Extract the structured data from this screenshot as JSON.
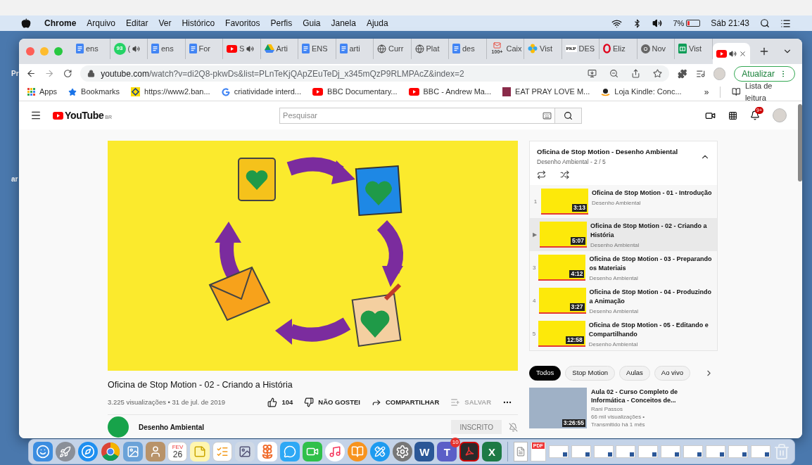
{
  "menu_bar": {
    "app": "Chrome",
    "menus": [
      "Arquivo",
      "Editar",
      "Ver",
      "Histórico",
      "Favoritos",
      "Perfis",
      "Guia",
      "Janela",
      "Ajuda"
    ],
    "battery": "7%",
    "clock": "Sáb 21:43"
  },
  "desktop_labels": [
    "Pr",
    "ar"
  ],
  "tabs": [
    {
      "kind": "docs",
      "title": "ens",
      "audio": false,
      "selected": false
    },
    {
      "kind": "whatsapp",
      "badge": "93",
      "title": "(",
      "audio": true,
      "selected": false
    },
    {
      "kind": "docs",
      "title": "ens",
      "audio": false,
      "selected": false
    },
    {
      "kind": "docs",
      "title": "For",
      "audio": false,
      "selected": false
    },
    {
      "kind": "youtube",
      "title": "S",
      "audio": true,
      "selected": false
    },
    {
      "kind": "drive",
      "title": "Arti",
      "audio": false,
      "selected": false
    },
    {
      "kind": "docs",
      "title": "ENS",
      "audio": false,
      "selected": false
    },
    {
      "kind": "docs",
      "title": "arti",
      "audio": false,
      "selected": false
    },
    {
      "kind": "globe",
      "title": "Curr",
      "audio": false,
      "selected": false
    },
    {
      "kind": "globe",
      "title": "Plat",
      "audio": false,
      "selected": false
    },
    {
      "kind": "docs",
      "title": "des",
      "audio": false,
      "selected": false
    },
    {
      "kind": "gmail",
      "badge": "100+",
      "title": "Caix",
      "audio": false,
      "selected": false
    },
    {
      "kind": "pinwheel",
      "title": "Vist",
      "audio": false,
      "selected": false
    },
    {
      "kind": "pkp",
      "badge": "PKP",
      "title": "DES",
      "audio": false,
      "selected": false
    },
    {
      "kind": "opera",
      "title": "Eliz",
      "audio": false,
      "selected": false
    },
    {
      "kind": "chrome",
      "title": "Nov",
      "audio": false,
      "selected": false
    },
    {
      "kind": "sheets",
      "title": "Vist",
      "audio": false,
      "selected": false
    },
    {
      "kind": "youtube",
      "audio": true,
      "selected": true
    }
  ],
  "address_bar": {
    "domain": "youtube.com",
    "path": "/watch?v=di2Q8-pkwDs&list=PLnTeKjQApZEuTeDj_x345mQzP9RLMPAcZ&index=2"
  },
  "update_button": "Atualizar",
  "bookmarks": [
    {
      "kind": "apps",
      "label": "Apps"
    },
    {
      "kind": "star",
      "label": "Bookmarks"
    },
    {
      "kind": "bank",
      "label": "https://www2.ban..."
    },
    {
      "kind": "google",
      "label": "criatividade interd..."
    },
    {
      "kind": "youtube",
      "label": "BBC Documentary..."
    },
    {
      "kind": "youtube",
      "label": "BBC - Andrew Ma..."
    },
    {
      "kind": "book",
      "label": "EAT PRAY LOVE M..."
    },
    {
      "kind": "amazon",
      "label": "Loja Kindle: Conc..."
    }
  ],
  "bookmarks_overflow": "»",
  "reading_list": "Lista de leitura",
  "youtube": {
    "logo": "YouTube",
    "region": "BR",
    "search_placeholder": "Pesquisar",
    "notifications": "9+"
  },
  "video": {
    "title": "Oficina de Stop Motion - 02 - Criando a História",
    "stats": "3.225 visualizações • 31 de jul. de 2019",
    "actions": [
      {
        "kind": "like",
        "label": "104",
        "disabled": false
      },
      {
        "kind": "dislike",
        "label": "NÃO GOSTEI",
        "disabled": false
      },
      {
        "kind": "share",
        "label": "COMPARTILHAR",
        "disabled": false
      },
      {
        "kind": "save",
        "label": "SALVAR",
        "disabled": true
      }
    ],
    "channel": "Desenho Ambiental",
    "subscribe": "INSCRITO"
  },
  "playlist": {
    "title": "Oficina de Stop Motion - Desenho Ambiental",
    "subtitle": "Desenho Ambiental - 2 / 5",
    "items": [
      {
        "index": "1",
        "title": "Oficina de Stop Motion - 01 - Introdução",
        "channel": "Desenho Ambiental",
        "duration": "3:13",
        "selected": false
      },
      {
        "index": "▶",
        "title": "Oficina de Stop Motion - 02 - Criando a História",
        "channel": "Desenho Ambiental",
        "duration": "5:07",
        "selected": true
      },
      {
        "index": "3",
        "title": "Oficina de Stop Motion - 03 - Preparando os Materiais",
        "channel": "Desenho Ambiental",
        "duration": "4:12",
        "selected": false
      },
      {
        "index": "4",
        "title": "Oficina de Stop Motion - 04 - Produzindo a Animação",
        "channel": "Desenho Ambiental",
        "duration": "3:27",
        "selected": false
      },
      {
        "index": "5",
        "title": "Oficina de Stop Motion - 05 - Editando e Compartilhando",
        "channel": "Desenho Ambiental",
        "duration": "12:58",
        "selected": false
      }
    ]
  },
  "chips": [
    {
      "label": "Todos",
      "selected": true
    },
    {
      "label": "Stop Motion",
      "selected": false
    },
    {
      "label": "Aulas",
      "selected": false
    },
    {
      "label": "Ao vivo",
      "selected": false
    }
  ],
  "recommendations": [
    {
      "title": "Aula 02 - Curso Completo de Informática - Conceitos de...",
      "channel": "Rani Passos",
      "views": "66 mil visualizações •",
      "age": "Transmitido há 1 mês",
      "duration": "3:26:55"
    }
  ],
  "dock": [
    {
      "kind": "finder"
    },
    {
      "kind": "launchpad"
    },
    {
      "kind": "safari"
    },
    {
      "kind": "chrome"
    },
    {
      "kind": "preview"
    },
    {
      "kind": "contacts"
    },
    {
      "kind": "calendar",
      "month": "FEV",
      "label": "26"
    },
    {
      "kind": "notes"
    },
    {
      "kind": "reminders"
    },
    {
      "kind": "slideshow"
    },
    {
      "kind": "photos"
    },
    {
      "kind": "messages"
    },
    {
      "kind": "facetime"
    },
    {
      "kind": "music"
    },
    {
      "kind": "books"
    },
    {
      "kind": "appstore"
    },
    {
      "kind": "settings"
    },
    {
      "kind": "word",
      "label": "W"
    },
    {
      "kind": "teams",
      "label": "T",
      "badge": "10"
    },
    {
      "kind": "acrobat"
    },
    {
      "kind": "excel",
      "label": "X"
    },
    {
      "kind": "separator"
    },
    {
      "kind": "document"
    },
    {
      "kind": "pdf",
      "label": "PDF"
    },
    {
      "kind": "thumb"
    },
    {
      "kind": "thumb"
    },
    {
      "kind": "thumb"
    },
    {
      "kind": "thumb"
    },
    {
      "kind": "thumb"
    },
    {
      "kind": "thumb"
    },
    {
      "kind": "thumb"
    },
    {
      "kind": "thumb"
    },
    {
      "kind": "thumb"
    },
    {
      "kind": "thumb"
    },
    {
      "kind": "trash"
    }
  ]
}
